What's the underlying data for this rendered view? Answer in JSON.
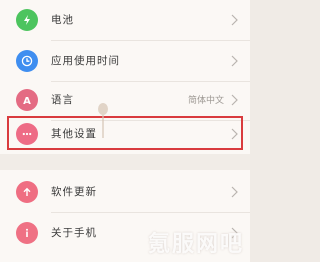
{
  "settings": {
    "items": [
      {
        "label": "电池",
        "value": "",
        "icon": "battery-icon",
        "color": "#4cc45e"
      },
      {
        "label": "应用使用时间",
        "value": "",
        "icon": "clock-icon",
        "color": "#3f8ef0"
      },
      {
        "label": "语言",
        "value": "简体中文",
        "icon": "language-icon",
        "color": "#e46b83"
      },
      {
        "label": "其他设置",
        "value": "",
        "icon": "more-icon",
        "color": "#ee6c86"
      },
      {
        "label": "软件更新",
        "value": "",
        "icon": "update-icon",
        "color": "#ef6e82"
      },
      {
        "label": "关于手机",
        "value": "",
        "icon": "info-icon",
        "color": "#ef7184"
      }
    ]
  },
  "watermark": "氪服网吧",
  "colors": {
    "highlight": "#d93b3e",
    "background": "#f1ece7"
  }
}
